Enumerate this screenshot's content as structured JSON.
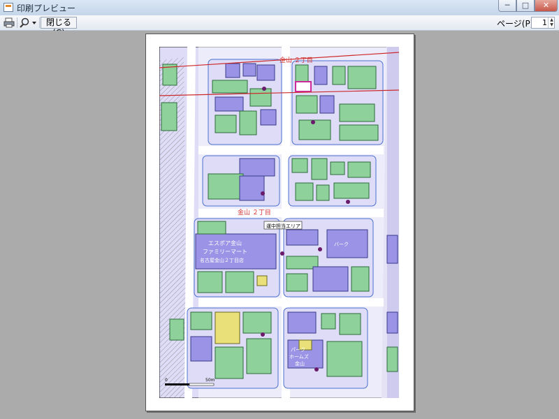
{
  "window": {
    "title": "印刷プレビュー",
    "minimize_glyph": "─",
    "maximize_glyph": "□",
    "close_glyph": "✕"
  },
  "toolbar": {
    "print_icon": "printer-icon",
    "zoom_icon": "magnifier-icon",
    "close_label": "閉じる(C)",
    "page_label": "ページ(P)",
    "page_value": "1"
  },
  "map": {
    "block_label_top": "金山 ２丁目",
    "block_label_middle": "金山 ２丁目",
    "callout": "運中担当エリア",
    "store_name_1": "エスポア金山",
    "store_name_2": "ファミリーマート",
    "store_name_3": "名古屋金山２丁目店",
    "store_label": "バーク",
    "park_label_1": "パーク",
    "park_label_2": "ホームズ",
    "park_label_3": "金山",
    "scale_0": "0",
    "scale_50": "50m",
    "colors": {
      "building": "#9b94e6",
      "residence": "#8fd19a",
      "commercial": "#e9e07a",
      "block_outline": "#4a6fd0",
      "road": "#ffffff",
      "rail": "#cc2a2a",
      "background": "#dedcf6"
    }
  }
}
